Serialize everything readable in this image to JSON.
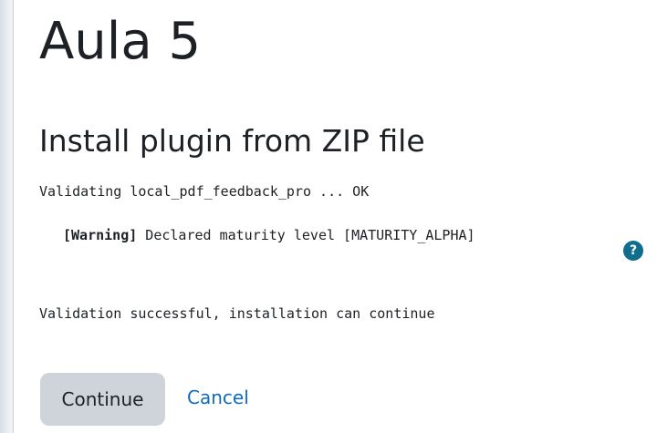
{
  "site": {
    "title": "Aula 5"
  },
  "section": {
    "title": "Install plugin from ZIP file"
  },
  "validation": {
    "validating_line": "Validating local_pdf_feedback_pro ... OK",
    "warning_tag": "[Warning]",
    "warning_text": " Declared maturity level [MATURITY_ALPHA]",
    "help_icon_glyph": "?",
    "success_line": "Validation successful, installation can continue"
  },
  "actions": {
    "continue_label": "Continue",
    "cancel_label": "Cancel"
  },
  "colors": {
    "help_icon_bg": "#0f6e8c",
    "link": "#0f6cbf",
    "button_bg": "#ced4da",
    "text": "#1d2125"
  },
  "icons": {
    "help": "question-circle-icon"
  }
}
